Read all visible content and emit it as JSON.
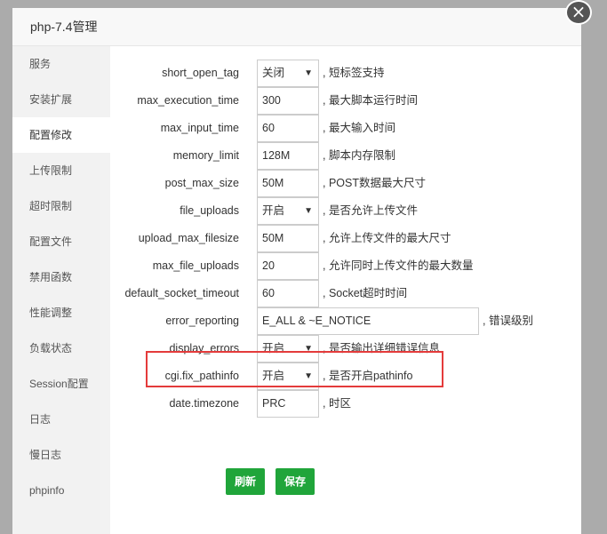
{
  "dialog": {
    "title": "php-7.4管理",
    "close_symbol": "×"
  },
  "sidebar": {
    "items": [
      {
        "label": "服务"
      },
      {
        "label": "安装扩展"
      },
      {
        "label": "配置修改"
      },
      {
        "label": "上传限制"
      },
      {
        "label": "超时限制"
      },
      {
        "label": "配置文件"
      },
      {
        "label": "禁用函数"
      },
      {
        "label": "性能调整"
      },
      {
        "label": "负载状态"
      },
      {
        "label": "Session配置"
      },
      {
        "label": "日志"
      },
      {
        "label": "慢日志"
      },
      {
        "label": "phpinfo"
      }
    ],
    "active": "配置修改"
  },
  "config": {
    "rows": [
      {
        "name": "short_open_tag",
        "value": "关闭",
        "note": ", 短标签支持"
      },
      {
        "name": "max_execution_time",
        "value": "300",
        "note": ", 最大脚本运行时间"
      },
      {
        "name": "max_input_time",
        "value": "60",
        "note": ", 最大输入时间"
      },
      {
        "name": "memory_limit",
        "value": "128M",
        "note": ", 脚本内存限制"
      },
      {
        "name": "post_max_size",
        "value": "50M",
        "note": ", POST数据最大尺寸"
      },
      {
        "name": "file_uploads",
        "value": "开启",
        "note": ", 是否允许上传文件"
      },
      {
        "name": "upload_max_filesize",
        "value": "50M",
        "note": ", 允许上传文件的最大尺寸"
      },
      {
        "name": "max_file_uploads",
        "value": "20",
        "note": ", 允许同时上传文件的最大数量"
      },
      {
        "name": "default_socket_timeout",
        "value": "60",
        "note": ", Socket超时时间"
      },
      {
        "name": "error_reporting",
        "value": "E_ALL & ~E_NOTICE",
        "note": ", 错误级别"
      },
      {
        "name": "display_errors",
        "value": "开启",
        "note": ", 是否输出详细错误信息"
      },
      {
        "name": "cgi.fix_pathinfo",
        "value": "开启",
        "note": ", 是否开启pathinfo"
      },
      {
        "name": "date.timezone",
        "value": "PRC",
        "note": ", 时区"
      }
    ]
  },
  "buttons": {
    "refresh": "刷新",
    "save": "保存"
  },
  "colors": {
    "accent": "#20a53a",
    "highlight": "#e43b3b"
  }
}
